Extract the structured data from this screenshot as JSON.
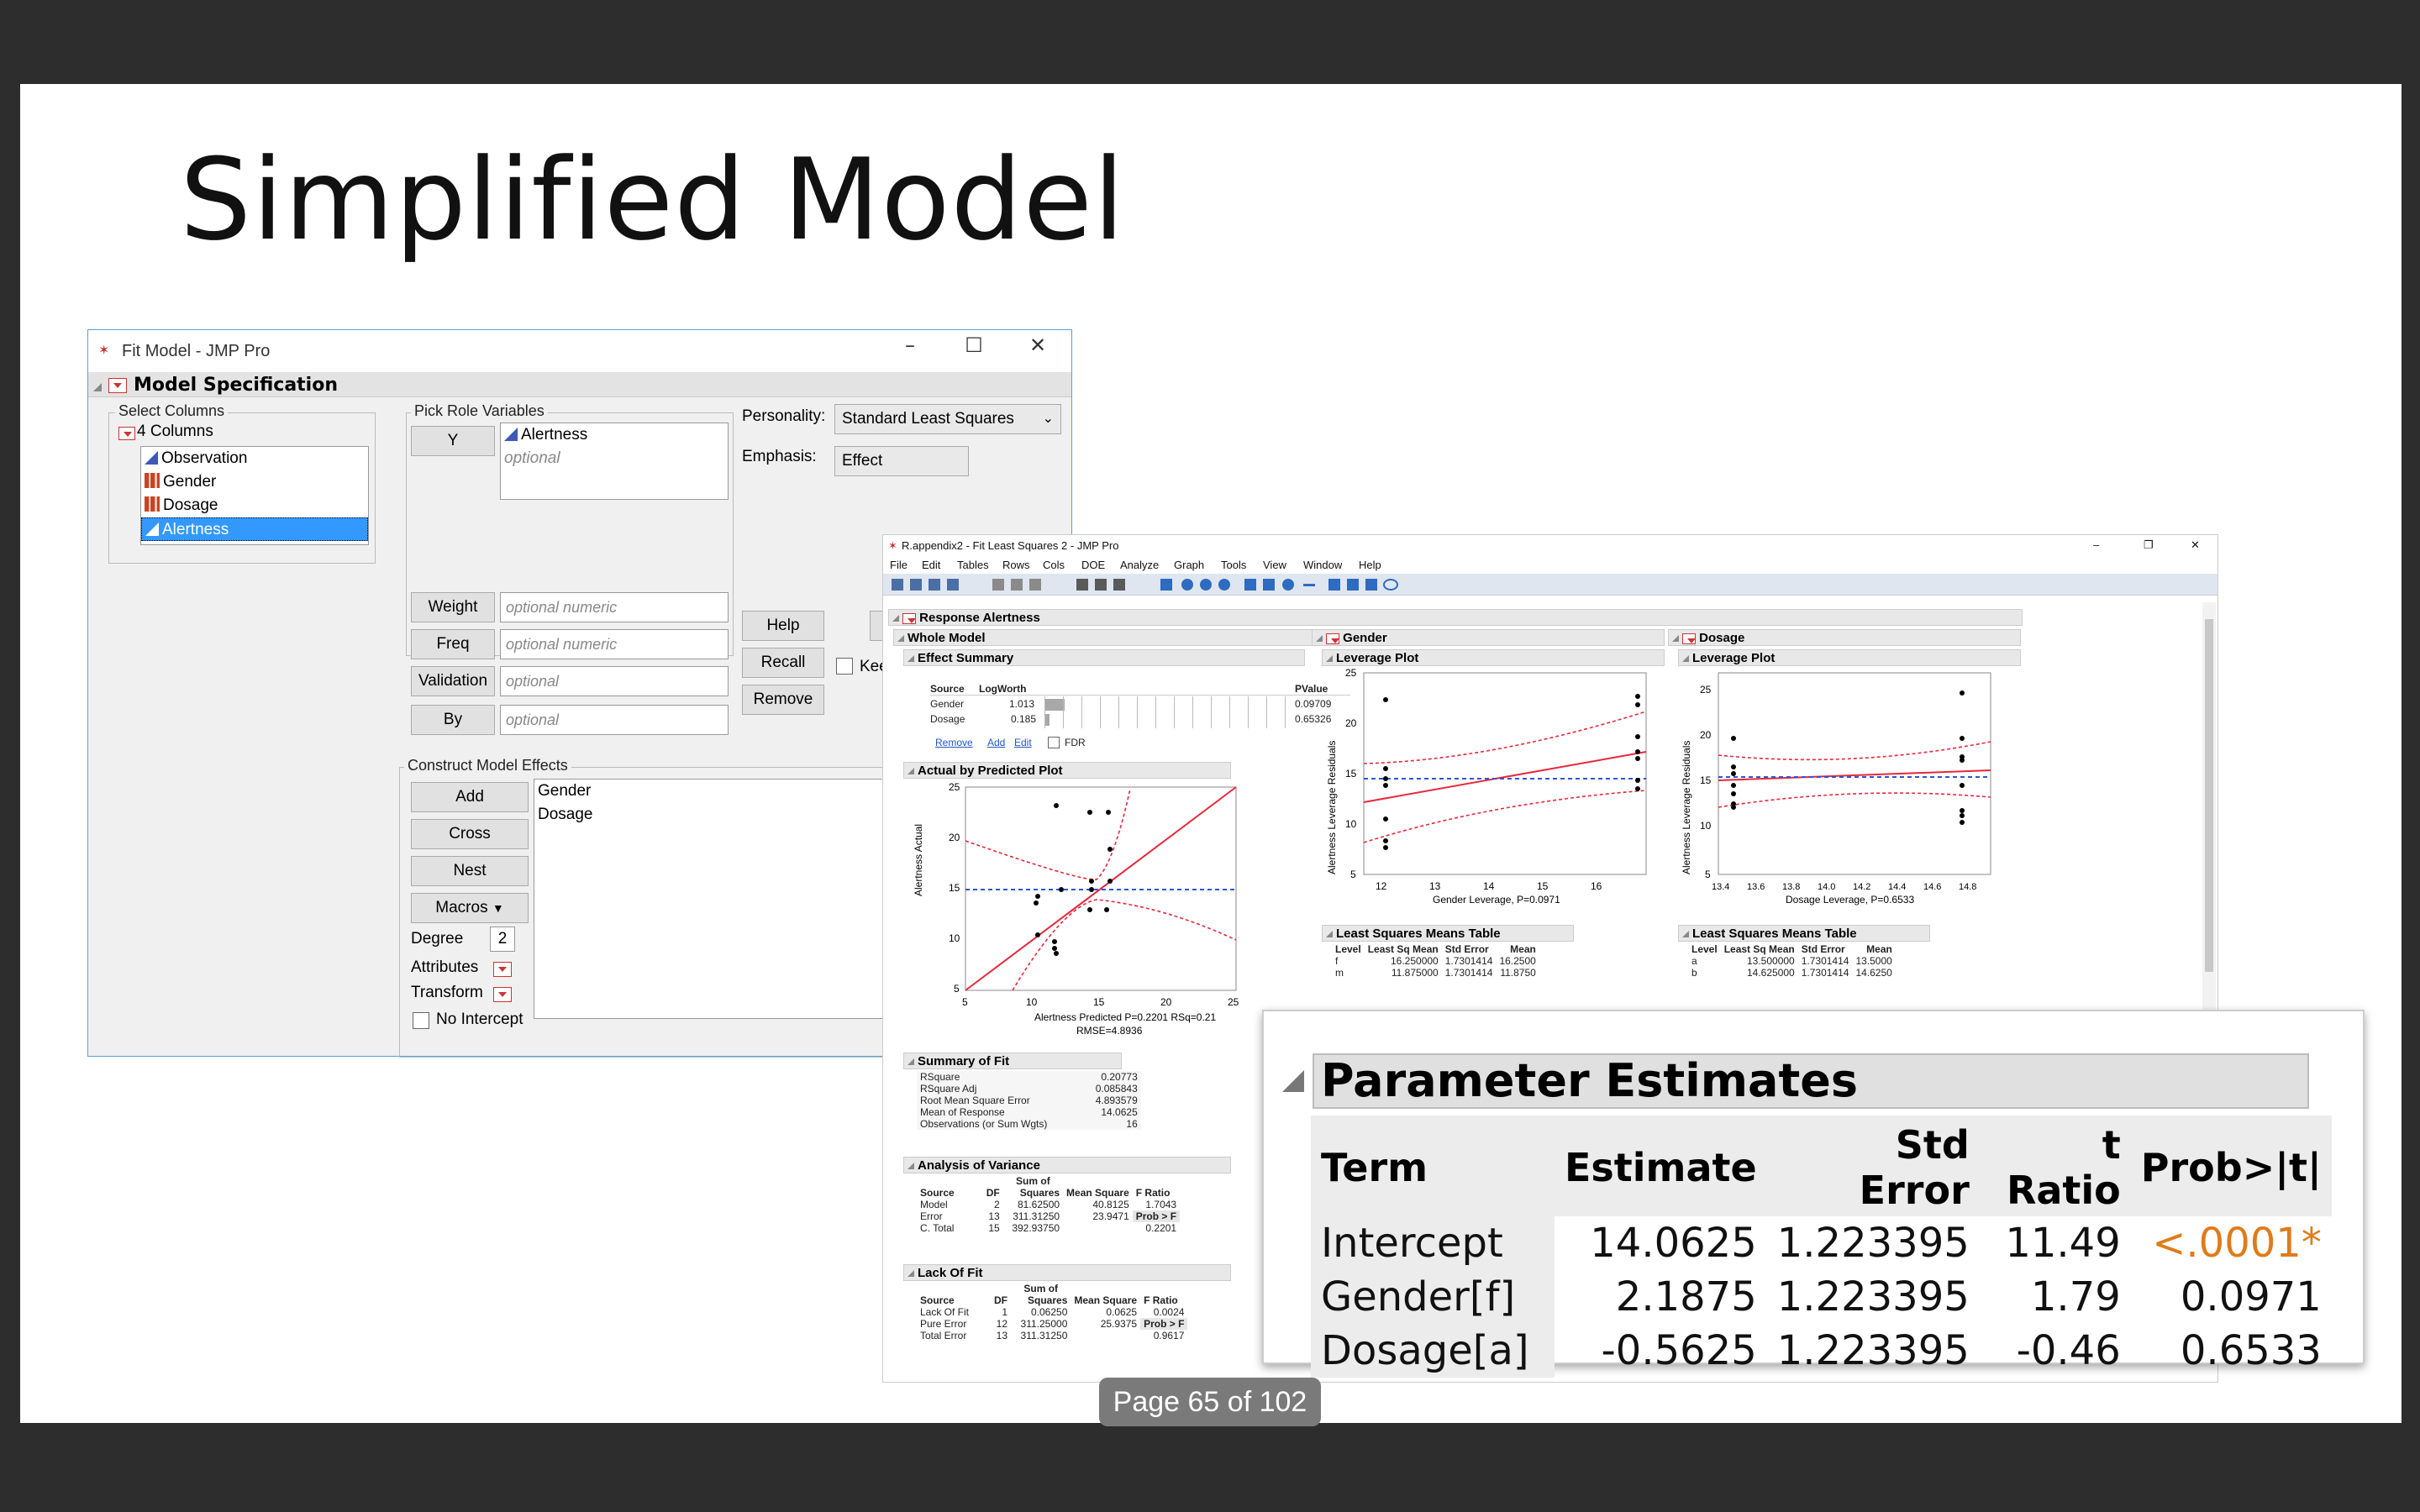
{
  "slide": {
    "title": "Simplified Model",
    "page_indicator": "Page 65 of 102"
  },
  "fit_model": {
    "window_title": "Fit Model - JMP Pro",
    "header": "Model Specification",
    "select_columns": {
      "label": "Select Columns",
      "count_label": "4 Columns",
      "items": [
        "Observation",
        "Gender",
        "Dosage",
        "Alertness"
      ],
      "selected": "Alertness"
    },
    "pick_role": {
      "label": "Pick Role Variables",
      "y_label": "Y",
      "y_value": "Alertness",
      "y_placeholder": "optional",
      "weight_label": "Weight",
      "weight_placeholder": "optional numeric",
      "freq_label": "Freq",
      "freq_placeholder": "optional numeric",
      "validation_label": "Validation",
      "validation_placeholder": "optional",
      "by_label": "By",
      "by_placeholder": "optional"
    },
    "personality_label": "Personality:",
    "personality_value": "Standard Least Squares",
    "emphasis_label": "Emphasis:",
    "emphasis_value": "Effect",
    "help_label": "Help",
    "recall_label": "Recall",
    "remove_label": "Remove",
    "keep_label": "Kee",
    "construct": {
      "label": "Construct Model Effects",
      "add": "Add",
      "cross": "Cross",
      "nest": "Nest",
      "macros": "Macros",
      "degree_label": "Degree",
      "degree_value": "2",
      "attributes_label": "Attributes",
      "transform_label": "Transform",
      "no_intercept_label": "No Intercept",
      "effects": [
        "Gender",
        "Dosage"
      ]
    }
  },
  "fls": {
    "window_title": "R.appendix2 - Fit Least Squares 2 - JMP Pro",
    "menu": [
      "File",
      "Edit",
      "Tables",
      "Rows",
      "Cols",
      "DOE",
      "Analyze",
      "Graph",
      "Tools",
      "View",
      "Window",
      "Help"
    ],
    "response": "Response Alertness",
    "whole_model": "Whole Model",
    "effect_summary": {
      "title": "Effect Summary",
      "headers": [
        "Source",
        "LogWorth",
        "PValue"
      ],
      "rows": [
        [
          "Gender",
          "1.013",
          "0.09709"
        ],
        [
          "Dosage",
          "0.185",
          "0.65326"
        ]
      ],
      "links": [
        "Remove",
        "Add",
        "Edit"
      ],
      "fdr_label": "FDR"
    },
    "actual_by_predicted": {
      "title": "Actual by Predicted Plot",
      "ylabel": "Alertness Actual",
      "xlabel": "Alertness Predicted P=0.2201 RSq=0.21",
      "xlabel2": "RMSE=4.8936",
      "x_ticks": [
        "5",
        "10",
        "15",
        "20",
        "25"
      ],
      "y_ticks": [
        "25",
        "20",
        "15",
        "10",
        "5"
      ]
    },
    "summary_of_fit": {
      "title": "Summary of Fit",
      "rows": [
        [
          "RSquare",
          "0.20773"
        ],
        [
          "RSquare Adj",
          "0.085843"
        ],
        [
          "Root Mean Square Error",
          "4.893579"
        ],
        [
          "Mean of Response",
          "14.0625"
        ],
        [
          "Observations (or Sum Wgts)",
          "16"
        ]
      ]
    },
    "anova": {
      "title": "Analysis of Variance",
      "sum_of": "Sum of",
      "headers": [
        "Source",
        "DF",
        "Squares",
        "Mean Square",
        "F Ratio"
      ],
      "rows": [
        [
          "Model",
          "2",
          "81.62500",
          "40.8125",
          "1.7043"
        ],
        [
          "Error",
          "13",
          "311.31250",
          "23.9471",
          "Prob > F"
        ],
        [
          "C. Total",
          "15",
          "392.93750",
          "",
          "0.2201"
        ]
      ]
    },
    "lack_of_fit": {
      "title": "Lack Of Fit",
      "sum_of": "Sum of",
      "headers": [
        "Source",
        "DF",
        "Squares",
        "Mean Square",
        "F Ratio"
      ],
      "rows": [
        [
          "Lack Of Fit",
          "1",
          "0.06250",
          "0.0625",
          "0.0024"
        ],
        [
          "Pure Error",
          "12",
          "311.25000",
          "25.9375",
          "Prob > F"
        ],
        [
          "Total Error",
          "13",
          "311.31250",
          "",
          "0.9617"
        ]
      ]
    },
    "gender": {
      "title": "Gender",
      "plot_title": "Leverage Plot",
      "ylabel": "Alertness Leverage Residuals",
      "xlabel": "Gender Leverage, P=0.0971",
      "x_ticks": [
        "12",
        "13",
        "14",
        "15",
        "16"
      ],
      "y_ticks": [
        "25",
        "20",
        "15",
        "10",
        "5"
      ],
      "lsm_title": "Least Squares Means Table",
      "lsm_headers": [
        "Level",
        "Least Sq Mean",
        "Std Error",
        "Mean"
      ],
      "lsm_rows": [
        [
          "f",
          "16.250000",
          "1.7301414",
          "16.2500"
        ],
        [
          "m",
          "11.875000",
          "1.7301414",
          "11.8750"
        ]
      ]
    },
    "dosage": {
      "title": "Dosage",
      "plot_title": "Leverage Plot",
      "ylabel": "Alertness Leverage Residuals",
      "xlabel": "Dosage Leverage, P=0.6533",
      "x_ticks": [
        "13.4",
        "13.6",
        "13.8",
        "14.0",
        "14.2",
        "14.4",
        "14.6",
        "14.8"
      ],
      "y_ticks": [
        "25",
        "20",
        "15",
        "10",
        "5"
      ],
      "lsm_title": "Least Squares Means Table",
      "lsm_headers": [
        "Level",
        "Least Sq Mean",
        "Std Error",
        "Mean"
      ],
      "lsm_rows": [
        [
          "a",
          "13.500000",
          "1.7301414",
          "13.5000"
        ],
        [
          "b",
          "14.625000",
          "1.7301414",
          "14.6250"
        ]
      ]
    }
  },
  "parameter_estimates": {
    "title": "Parameter Estimates",
    "headers": [
      "Term",
      "Estimate",
      "Std Error",
      "t Ratio",
      "Prob>|t|"
    ],
    "rows": [
      [
        "Intercept",
        "14.0625",
        "1.223395",
        "11.49",
        "<.0001*"
      ],
      [
        "Gender[f]",
        "2.1875",
        "1.223395",
        "1.79",
        "0.0971"
      ],
      [
        "Dosage[a]",
        "-0.5625",
        "1.223395",
        "-0.46",
        "0.6533"
      ]
    ],
    "significant_color": "#e07b1a"
  },
  "colors": {
    "fit_line": "#e8283c",
    "mean_line": "#2b55d6",
    "selection": "#3399ff"
  }
}
